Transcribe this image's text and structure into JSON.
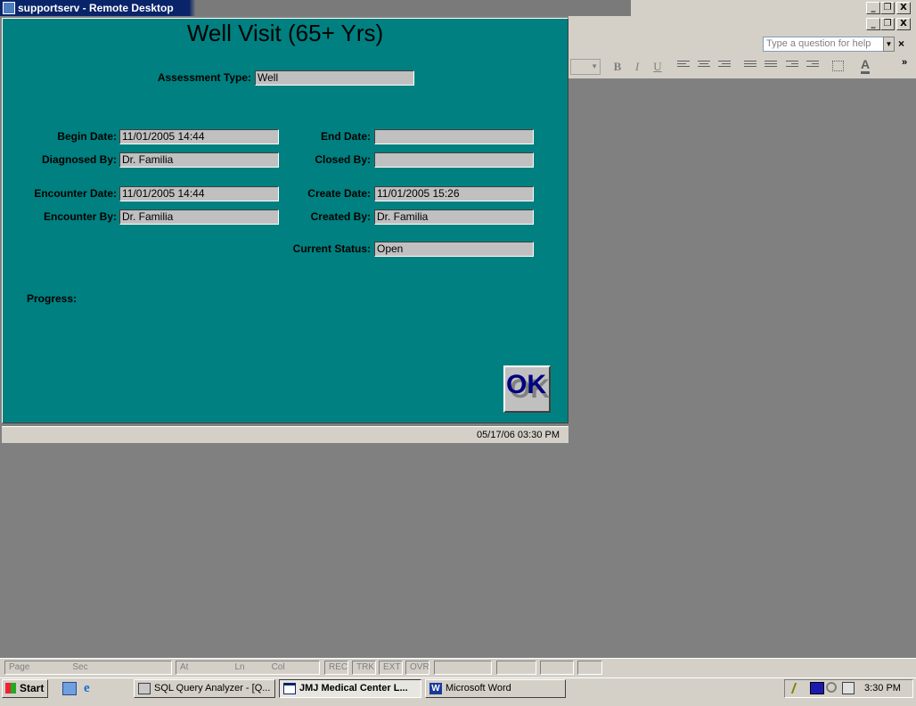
{
  "remote_desktop": {
    "title": "supportserv - Remote Desktop",
    "controls": [
      "_",
      "❐",
      "X"
    ]
  },
  "word_window": {
    "controls": [
      "_",
      "❐",
      "X"
    ],
    "help_placeholder": "Type a question for help",
    "help_close": "×",
    "toolbar": [
      "B",
      "I",
      "U"
    ],
    "status_bar": {
      "page": "Page",
      "sec": "Sec",
      "at": "At",
      "ln": "Ln",
      "col": "Col",
      "rec": "REC",
      "trk": "TRK",
      "ext": "EXT",
      "ovr": "OVR"
    }
  },
  "dialog": {
    "title": "Well Visit (65+ Yrs)",
    "assessment_type": {
      "label": "Assessment Type:",
      "value": "Well"
    },
    "begin_date": {
      "label": "Begin Date:",
      "value": "11/01/2005 14:44"
    },
    "end_date": {
      "label": "End Date:",
      "value": ""
    },
    "diagnosed_by": {
      "label": "Diagnosed By:",
      "value": "Dr. Familia"
    },
    "closed_by": {
      "label": "Closed By:",
      "value": ""
    },
    "encounter_date": {
      "label": "Encounter Date:",
      "value": "11/01/2005 14:44"
    },
    "create_date": {
      "label": "Create Date:",
      "value": "11/01/2005 15:26"
    },
    "encounter_by": {
      "label": "Encounter By:",
      "value": "Dr. Familia"
    },
    "created_by": {
      "label": "Created By:",
      "value": "Dr. Familia"
    },
    "current_status": {
      "label": "Current Status:",
      "value": "Open"
    },
    "progress_label": "Progress:",
    "ok_label": "OK",
    "status_datetime": "05/17/06  03:30 PM"
  },
  "taskbar": {
    "start": "Start",
    "tasks": [
      {
        "label": "SQL Query Analyzer - [Q...",
        "icon": "sql-icon",
        "active": false
      },
      {
        "label": "JMJ Medical Center  L...",
        "icon": "window-icon",
        "active": true
      },
      {
        "label": "Microsoft Word",
        "icon": "word-icon",
        "active": false
      }
    ],
    "clock": "3:30 PM"
  },
  "colors": {
    "dialog_bg": "#008080",
    "desktop_bg": "#808080",
    "chrome": "#d4d0c8",
    "titlebar": "#0a246a"
  }
}
